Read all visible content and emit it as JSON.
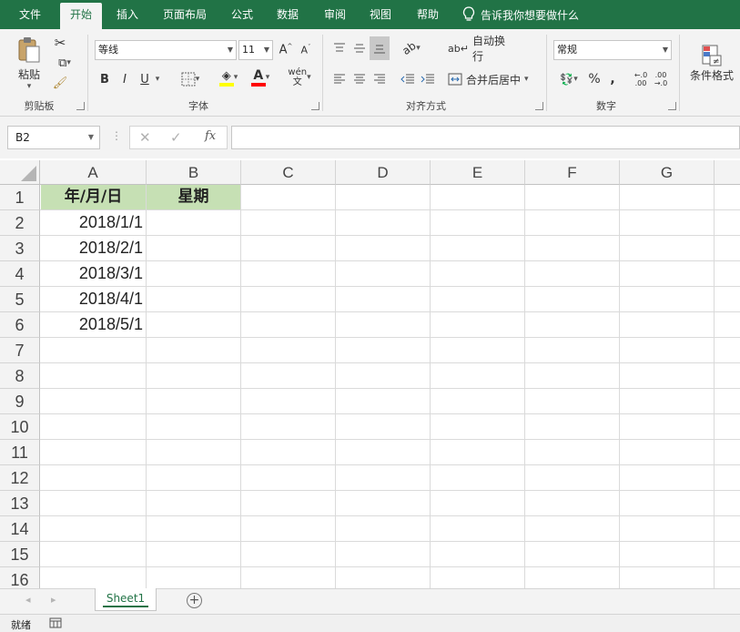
{
  "menu": {
    "tabs": [
      {
        "label": "文件"
      },
      {
        "label": "开始"
      },
      {
        "label": "插入"
      },
      {
        "label": "页面布局"
      },
      {
        "label": "公式"
      },
      {
        "label": "数据"
      },
      {
        "label": "审阅"
      },
      {
        "label": "视图"
      },
      {
        "label": "帮助"
      }
    ],
    "active_tab": "开始",
    "tell_me": "告诉我你想要做什么"
  },
  "ribbon": {
    "clipboard": {
      "paste_label": "粘贴",
      "group_label": "剪贴板"
    },
    "font": {
      "font_name": "等线",
      "font_size": "11",
      "bold": "B",
      "italic": "I",
      "underline": "U",
      "group_label": "字体",
      "font_color": "#ff0000",
      "fill_color": "#ffff00"
    },
    "alignment": {
      "wrap_text": "自动换行",
      "merge_center": "合并后居中",
      "group_label": "对齐方式"
    },
    "number": {
      "format": "常规",
      "percent": "%",
      "comma": ",",
      "group_label": "数字"
    },
    "styles": {
      "conditional_format": "条件格式"
    }
  },
  "formula_bar": {
    "name_box": "B2",
    "formula": "",
    "fx": "fx"
  },
  "grid": {
    "columns": [
      "A",
      "B",
      "C",
      "D",
      "E",
      "F",
      "G"
    ],
    "rows": [
      "1",
      "2",
      "3",
      "4",
      "5",
      "6",
      "7",
      "8",
      "9",
      "10",
      "11",
      "12",
      "13",
      "14",
      "15",
      "16"
    ],
    "header_row": {
      "a1": "年/月/日",
      "b1": "星期"
    },
    "dates": [
      "2018/1/1",
      "2018/2/1",
      "2018/3/1",
      "2018/4/1",
      "2018/5/1"
    ],
    "header_fill": "#c6e0b4"
  },
  "sheets": {
    "tabs": [
      "Sheet1"
    ],
    "active": "Sheet1",
    "add_sheet": "+"
  },
  "status": {
    "ready": "就绪"
  },
  "colors": {
    "accent": "#217346"
  }
}
